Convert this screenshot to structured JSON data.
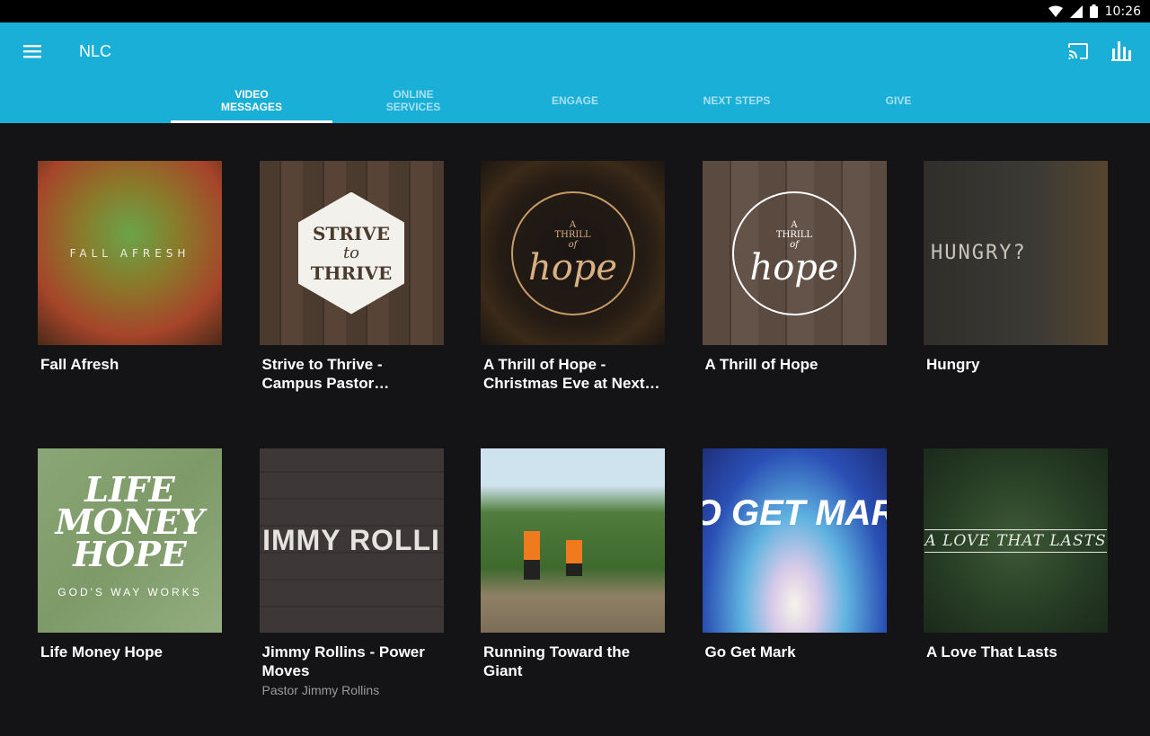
{
  "status": {
    "time": "10:26"
  },
  "appbar": {
    "title": "NLC"
  },
  "tabs": [
    {
      "label": "VIDEO\nMESSAGES",
      "active": true
    },
    {
      "label": "ONLINE\nSERVICES",
      "active": false
    },
    {
      "label": "ENGAGE",
      "active": false
    },
    {
      "label": "NEXT STEPS",
      "active": false
    },
    {
      "label": "GIVE",
      "active": false
    }
  ],
  "items": [
    {
      "title": "Fall Afresh",
      "subtitle": "",
      "art_text": "FALL  AFRESH"
    },
    {
      "title": "Strive to Thrive - Campus Pastor…",
      "subtitle": "",
      "art_text": [
        "STRIVE",
        "to",
        "THRIVE"
      ]
    },
    {
      "title": "A Thrill of Hope - Christmas Eve at Next…",
      "subtitle": "",
      "art_text": [
        "A",
        "THRILL",
        "of",
        "hope"
      ]
    },
    {
      "title": "A Thrill of Hope",
      "subtitle": "",
      "art_text": [
        "A",
        "THRILL",
        "of",
        "hope"
      ]
    },
    {
      "title": "Hungry",
      "subtitle": "",
      "art_text": "HUNGRY?"
    },
    {
      "title": "Life Money Hope",
      "subtitle": "",
      "art_text": [
        "LIFE",
        "MONEY",
        "HOPE",
        "GOD'S WAY WORKS"
      ]
    },
    {
      "title": "Jimmy Rollins - Power Moves",
      "subtitle": "Pastor Jimmy Rollins",
      "art_text": "IMMY ROLLI"
    },
    {
      "title": "Running Toward the Giant",
      "subtitle": "",
      "art_text": ""
    },
    {
      "title": "Go Get Mark",
      "subtitle": "",
      "art_text": "GO GET MARK"
    },
    {
      "title": "A Love That Lasts",
      "subtitle": "",
      "art_text": "A LOVE THAT LASTS"
    }
  ],
  "colors": {
    "appbar": "#1aafd6",
    "background": "#141417",
    "status": "#000000"
  }
}
